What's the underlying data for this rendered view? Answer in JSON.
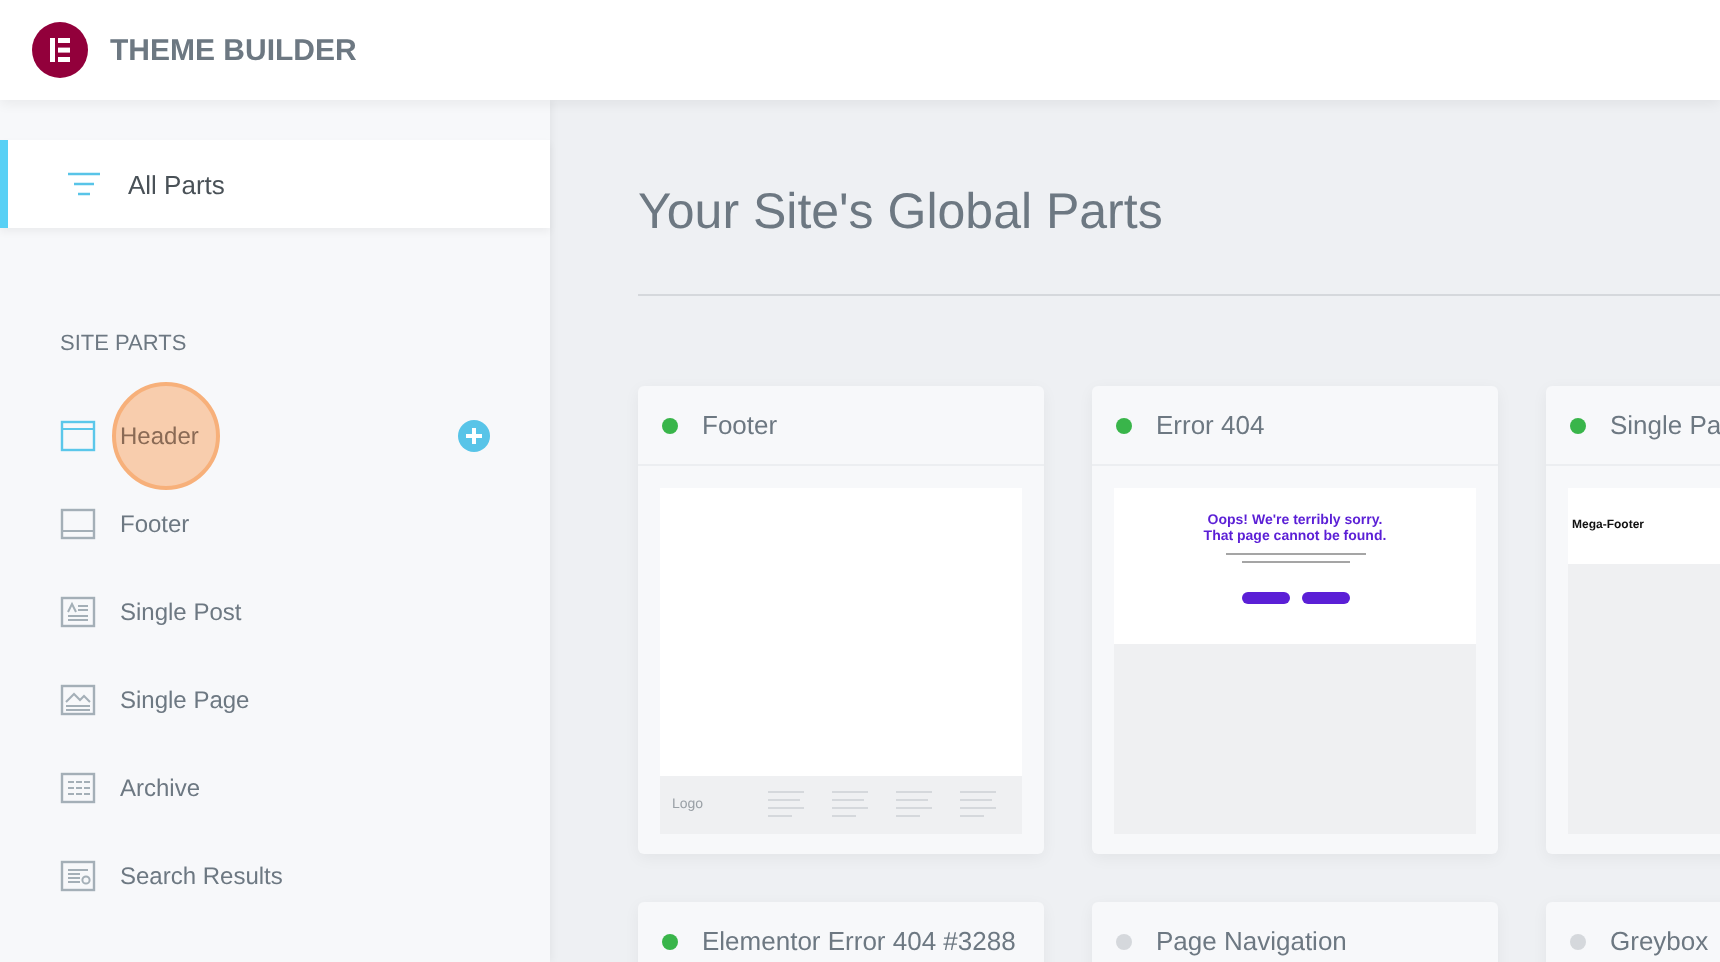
{
  "header": {
    "title": "THEME BUILDER"
  },
  "sidebar": {
    "all_parts": {
      "label": "All Parts",
      "selected": true
    },
    "section_title": "SITE PARTS",
    "items": [
      {
        "label": "Header",
        "kind": "header",
        "hovered": true
      },
      {
        "label": "Footer",
        "kind": "footer",
        "hovered": false
      },
      {
        "label": "Single Post",
        "kind": "post",
        "hovered": false
      },
      {
        "label": "Single Page",
        "kind": "page",
        "hovered": false
      },
      {
        "label": "Archive",
        "kind": "archive",
        "hovered": false
      },
      {
        "label": "Search Results",
        "kind": "search",
        "hovered": false
      }
    ]
  },
  "main": {
    "title": "Your Site's Global Parts",
    "cards": [
      {
        "title": "Footer",
        "color": "#39b54a",
        "preview": {
          "kind": "footer",
          "label": "Logo"
        }
      },
      {
        "title": "Error 404",
        "color": "#39b54a",
        "preview": {
          "kind": "error",
          "heading": "Oops! We're terribly sorry.\nThat page cannot be found."
        }
      },
      {
        "title": "Single Pa",
        "color": "#39b54a",
        "preview": {
          "kind": "mega",
          "heading": "Mega-Footer"
        }
      },
      {
        "title": "Elementor Error 404 #3288",
        "color": "#39b54a"
      },
      {
        "title": "Page Navigation",
        "color": "#d5d8dc"
      },
      {
        "title": "Greybox",
        "color": "#d5d8dc"
      }
    ]
  }
}
